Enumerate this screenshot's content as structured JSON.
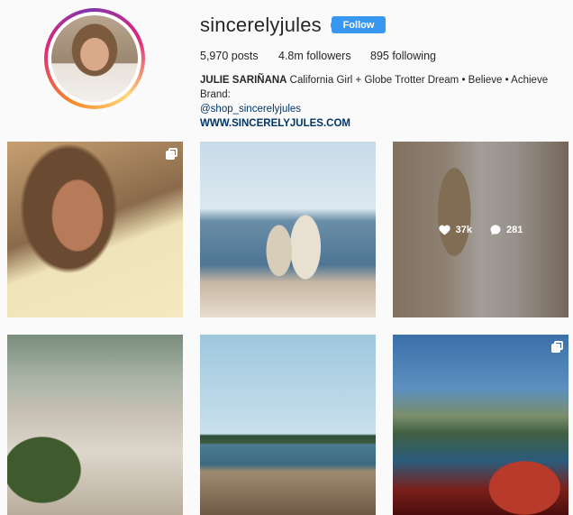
{
  "profile": {
    "username": "sincerelyjules",
    "verified_symbol": "✔",
    "follow_label": "Follow",
    "stats": {
      "posts": "5,970 posts",
      "followers": "4.8m followers",
      "following": "895 following"
    },
    "bio": {
      "name": "JULIE SARIÑANA",
      "text": " California Girl + Globe Trotter Dream • Believe • Achieve Brand:",
      "handle": "@shop_sincerelyjules",
      "website": "WWW.SINCERELYJULES.COM"
    }
  },
  "posts": [
    {
      "multi": true
    },
    {
      "multi": false
    },
    {
      "multi": false,
      "hover": {
        "likes": "37k",
        "comments": "281"
      }
    },
    {
      "multi": false
    },
    {
      "multi": false
    },
    {
      "multi": true
    }
  ],
  "colors": {
    "accent": "#3897f0",
    "link": "#003569",
    "text": "#262626"
  }
}
